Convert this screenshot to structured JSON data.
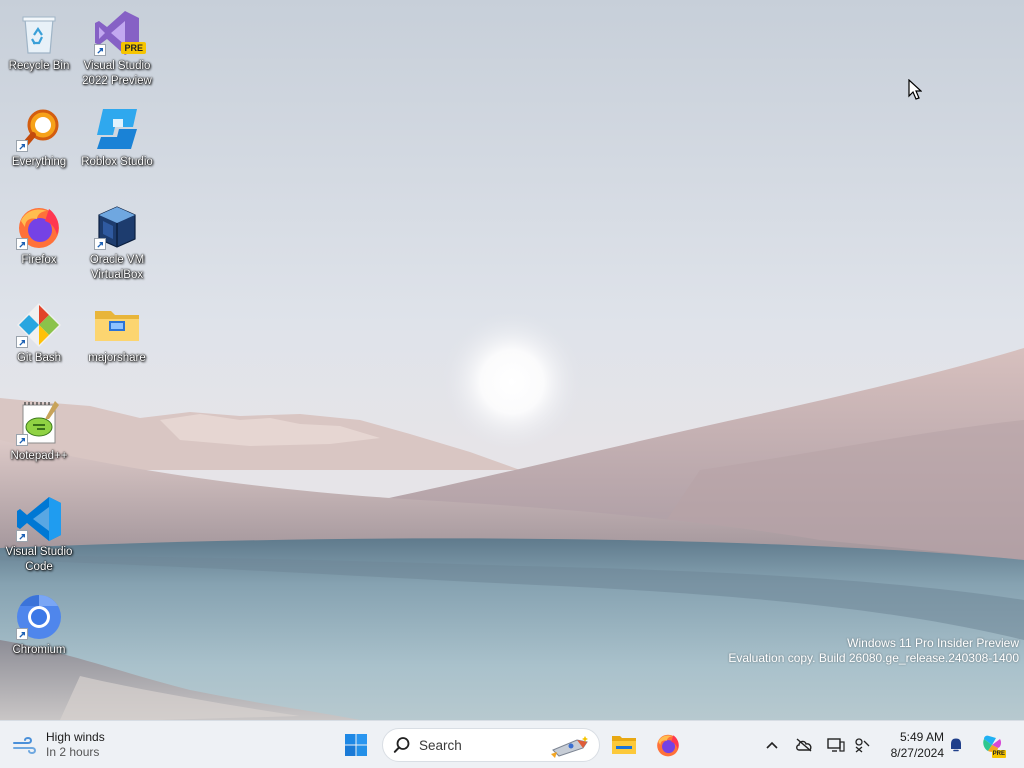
{
  "desktop_icons": [
    {
      "id": "recycle-bin",
      "label": "Recycle Bin",
      "shortcut": false
    },
    {
      "id": "visual-studio-2022-preview",
      "label": "Visual Studio\n2022 Preview",
      "shortcut": true,
      "badge": "PRE"
    },
    {
      "id": "everything",
      "label": "Everything",
      "shortcut": true
    },
    {
      "id": "roblox-studio",
      "label": "Roblox Studio",
      "shortcut": false
    },
    {
      "id": "firefox",
      "label": "Firefox",
      "shortcut": true
    },
    {
      "id": "oracle-vm-virtualbox",
      "label": "Oracle VM\nVirtualBox",
      "shortcut": true
    },
    {
      "id": "git-bash",
      "label": "Git Bash",
      "shortcut": true
    },
    {
      "id": "majorshare",
      "label": "majorshare",
      "shortcut": false
    },
    {
      "id": "notepad-plus-plus",
      "label": "Notepad++",
      "shortcut": true
    },
    {
      "id": "visual-studio-code",
      "label": "Visual Studio\nCode",
      "shortcut": true
    },
    {
      "id": "chromium",
      "label": "Chromium",
      "shortcut": true
    }
  ],
  "watermark": {
    "line1": "Windows 11 Pro Insider Preview",
    "line2": "Evaluation copy. Build 26080.ge_release.240308-1400"
  },
  "taskbar": {
    "weather": {
      "title": "High winds",
      "subtitle": "In 2 hours",
      "icon": "wind-icon"
    },
    "start": {
      "icon": "windows-logo-icon"
    },
    "search": {
      "placeholder": "Search",
      "icon": "search-icon"
    },
    "pinned": [
      {
        "id": "file-explorer",
        "icon": "folder-icon"
      },
      {
        "id": "firefox",
        "icon": "firefox-icon"
      }
    ],
    "tray": {
      "icons": [
        "chevron-up-icon",
        "cloud-offline-icon",
        "network-display-icon",
        "accessibility-icon",
        "notification-bell-icon",
        "copilot-icon"
      ],
      "copilot_badge": "PRE",
      "time": "5:49 AM",
      "date": "8/27/2024"
    }
  },
  "colors": {
    "taskbar_bg": "#eef1f5",
    "accent": "#0067c0"
  }
}
